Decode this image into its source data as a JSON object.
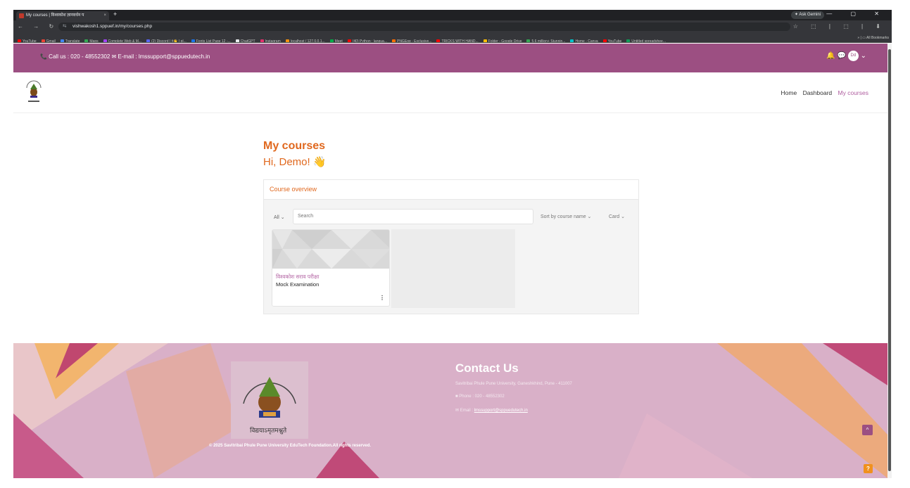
{
  "browser": {
    "tab_title": "My courses | विश्वकोश ज्ञानवर्धन प",
    "tab_close": "×",
    "new_tab": "+",
    "gemini": "✦ Ask Gemini",
    "window_controls": "— ▢ ✕",
    "nav_buttons": "← → ↻ ⌂",
    "url": "vishwakosh1.sppuef.in/my/courses.php",
    "url_icon": "⇆",
    "addr_right_icons": "☆ ⬚ | ⬚ | ⬇",
    "all_bookmarks": "» | ▭ All Bookmarks",
    "bookmarks": [
      {
        "label": "YouTube",
        "color": "#ff0000"
      },
      {
        "label": "Gmail",
        "color": "#ea4335"
      },
      {
        "label": "Translate",
        "color": "#4285f4"
      },
      {
        "label": "Maps",
        "color": "#34a853"
      },
      {
        "label": "Complete Web & M...",
        "color": "#a142f4"
      },
      {
        "label": "(2) Discord | #👋 | gl...",
        "color": "#5865f2"
      },
      {
        "label": "Fonts List Page 12 -...",
        "color": "#1a73e8"
      },
      {
        "label": "ChatGPT",
        "color": "#e8eaed"
      },
      {
        "label": "Instagram",
        "color": "#e1306c"
      },
      {
        "label": "localhost / 127.0.0.1...",
        "color": "#f29111"
      },
      {
        "label": "Meet",
        "color": "#00ac47"
      },
      {
        "label": "(40) Python : langua...",
        "color": "#ff0000"
      },
      {
        "label": "PNGEgg - Exclusive...",
        "color": "#ff6d00"
      },
      {
        "label": "TRICKS WITH HAND...",
        "color": "#ff0000"
      },
      {
        "label": "Folder - Google Drive",
        "color": "#fbbc04"
      },
      {
        "label": "5.6 million+ Stunnin...",
        "color": "#34a853"
      },
      {
        "label": "Home - Canva",
        "color": "#00c4cc"
      },
      {
        "label": "YouTube",
        "color": "#ff0000"
      },
      {
        "label": "Untitled spreadshee...",
        "color": "#0f9d58"
      }
    ]
  },
  "topbar": {
    "contact": "📞 Call us : 020 - 48552302 ✉ E-mail : lmssupport@sppuedutech.in",
    "icons": "🔔 💬",
    "avatar": "Dd",
    "avatar_caret": "⌄"
  },
  "nav": {
    "home": "Home",
    "dashboard": "Dashboard",
    "my_courses": "My courses"
  },
  "main": {
    "title": "My courses",
    "greeting": "Hi, Demo! 👋",
    "overview_title": "Course overview",
    "filter": "All ⌄",
    "search_placeholder": "Search",
    "sort": "Sort by course name ⌄",
    "view": "Card ⌄"
  },
  "course": {
    "title": "विश्वकोश सराव परीक्षा",
    "subtitle": "Mock Examination",
    "menu": "⋮"
  },
  "footer": {
    "motto": "विद्ययाऽमृतमश्नुते",
    "copyright": "© 2025 Savitribai Phule Pune University EduTech Foundation.All rights reserved.",
    "contact_title": "Contact Us",
    "address": "Savitribai Phule Pune University, Ganeshkhind, Pune - 411007",
    "phone": "Phone : 020 - 48552302",
    "email_label": "Email : ",
    "email": "lmssupport@sppuedutech.in",
    "to_top": "^",
    "help": "?"
  }
}
